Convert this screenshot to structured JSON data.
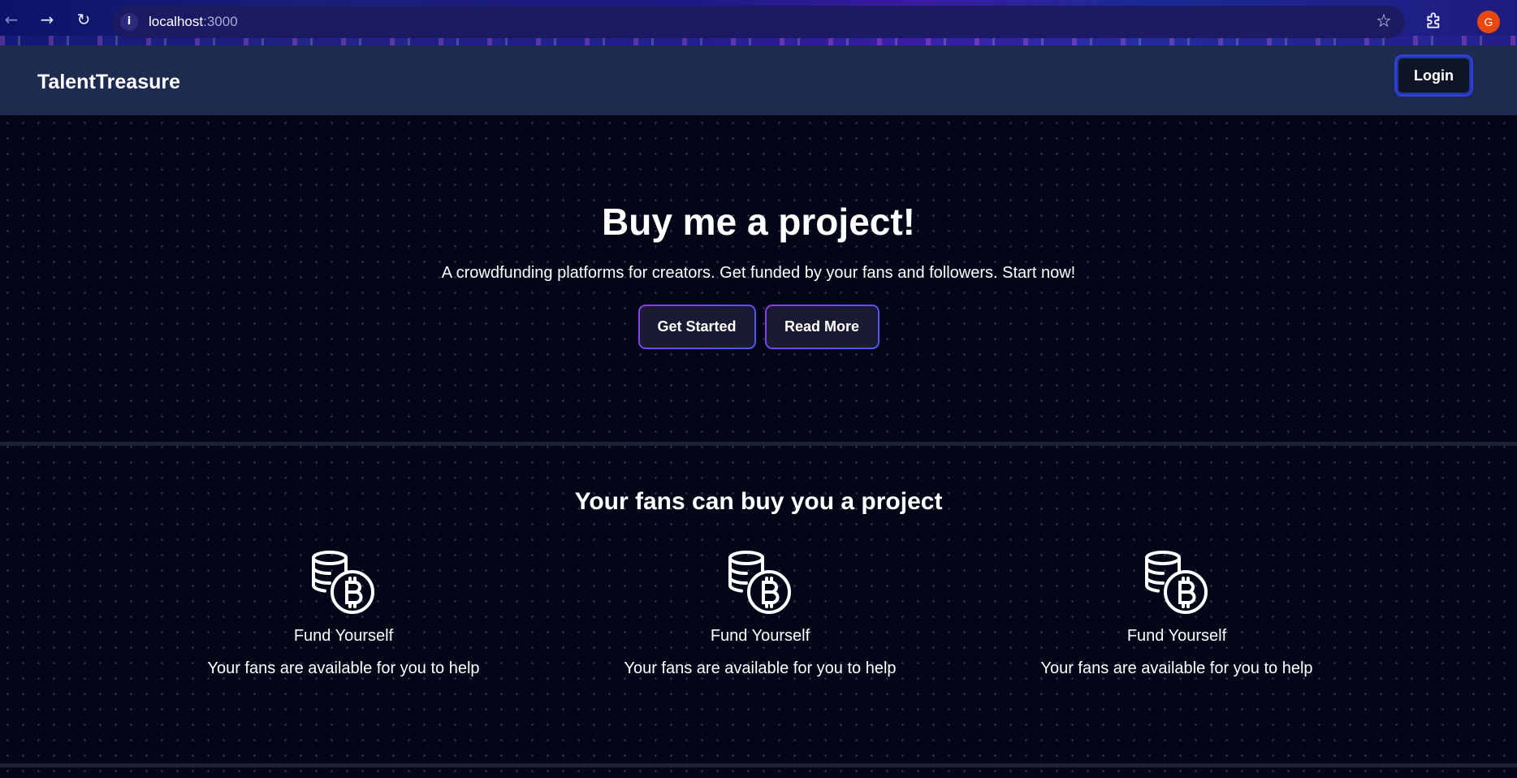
{
  "browser": {
    "url_host": "localhost",
    "url_port": ":3000",
    "profile_initial": "G",
    "icons": {
      "back": "arrow-left-icon",
      "forward": "arrow-right-icon",
      "reload": "reload-icon",
      "site_info": "info-icon",
      "bookmark": "star-icon",
      "extensions": "puzzle-icon"
    },
    "profile_color": "#e8470e"
  },
  "navbar": {
    "brand": "TalentTreasure",
    "login_label": "Login"
  },
  "hero": {
    "title": "Buy me a project!",
    "subtitle": "A crowdfunding platforms for creators. Get funded by your fans and followers. Start now!",
    "primary_label": "Get Started",
    "secondary_label": "Read More"
  },
  "features_section": {
    "title": "Your fans can buy you a project",
    "items": [
      {
        "icon": "coins-bitcoin-icon",
        "title": "Fund Yourself",
        "description": "Your fans are available for you to help"
      },
      {
        "icon": "coins-bitcoin-icon",
        "title": "Fund Yourself",
        "description": "Your fans are available for you to help"
      },
      {
        "icon": "coins-bitcoin-icon",
        "title": "Fund Yourself",
        "description": "Your fans are available for you to help"
      }
    ]
  },
  "colors": {
    "background": "#020617",
    "navbar": "#1e2b50",
    "accent_purple": "#8b3cf0",
    "accent_blue": "#4a58f2"
  }
}
